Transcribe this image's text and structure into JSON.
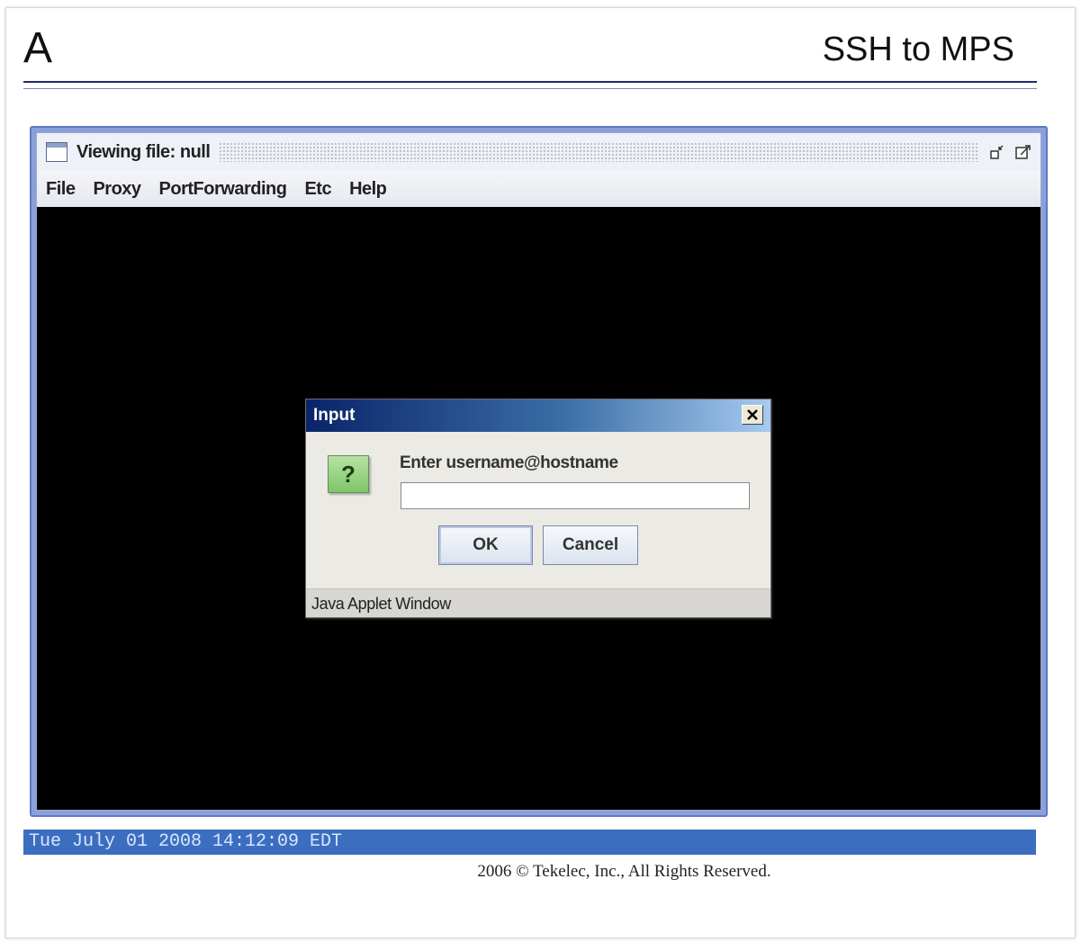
{
  "header": {
    "letter": "A",
    "title": "SSH to MPS"
  },
  "applet": {
    "window_title": "Viewing file: null",
    "menu": [
      "File",
      "Proxy",
      "PortForwarding",
      "Etc",
      "Help"
    ]
  },
  "dialog": {
    "title": "Input",
    "close_label": "x",
    "icon": "question-icon",
    "icon_glyph": "?",
    "prompt": "Enter username@hostname",
    "input_value": "",
    "ok_label": "OK",
    "cancel_label": "Cancel",
    "footer": "Java Applet Window"
  },
  "status": {
    "datetime": "Tue July 01 2008 14:12:09 EDT"
  },
  "footer": {
    "copyright": "2006 © Tekelec, Inc., All Rights Reserved."
  },
  "colors": {
    "status_bar": "#3c6ec0",
    "dialog_title": "#0a246a",
    "terminal_bg": "#000000"
  }
}
